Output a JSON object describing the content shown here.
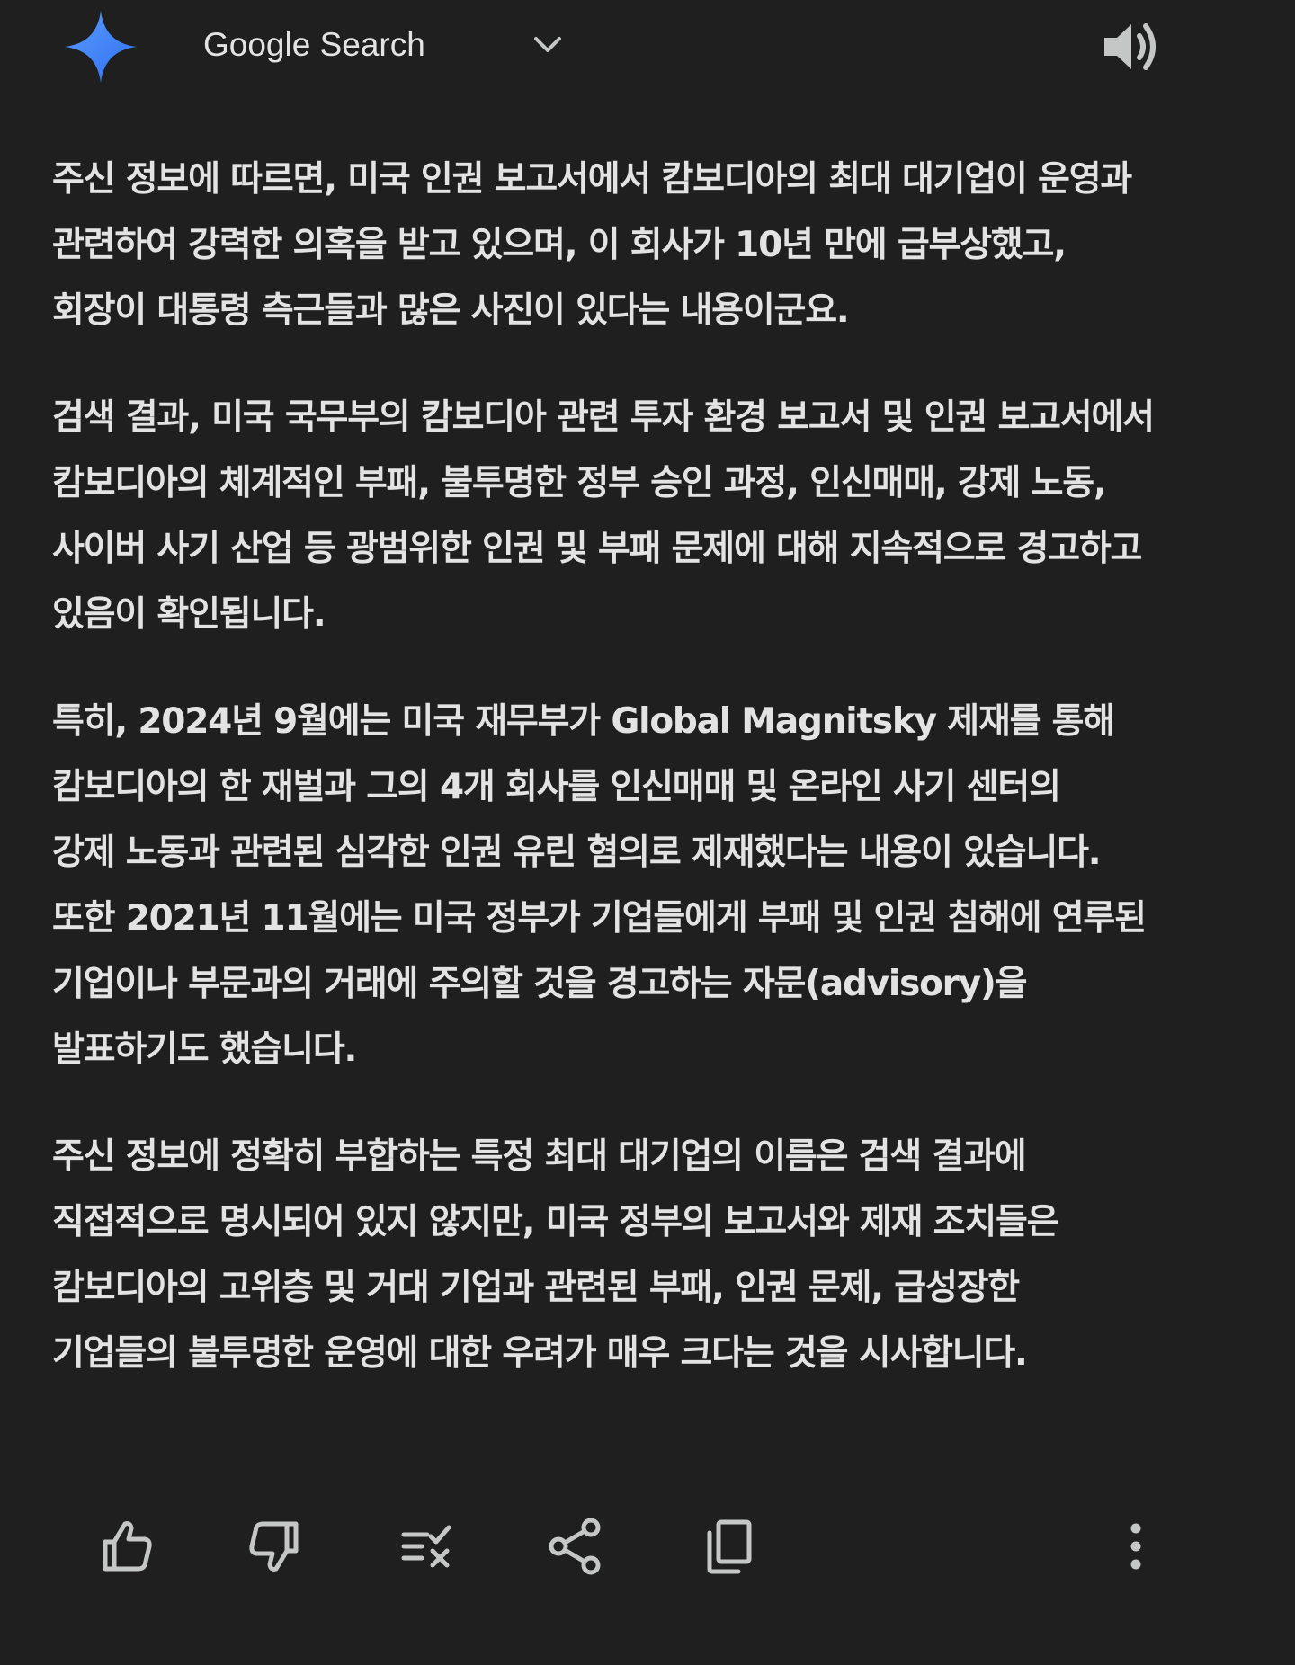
{
  "header": {
    "source_title": "Google Search",
    "logo_icon": "gemini-sparkle-icon",
    "dropdown_icon": "chevron-down-icon",
    "audio_icon": "speaker-icon",
    "accent_color": "#4285f4"
  },
  "answer": {
    "paragraphs": [
      "주신 정보에 따르면, 미국 인권 보고서에서 캄보디아의 최대 대기업이 운영과\n관련하여 강력한 의혹을 받고 있으며, 이 회사가 10년 만에 급부상했고,\n회장이 대통령 측근들과 많은 사진이 있다는 내용이군요.",
      "검색 결과, 미국 국무부의 캄보디아 관련 투자 환경 보고서 및 인권 보고서에서\n캄보디아의 체계적인 부패, 불투명한 정부 승인 과정, 인신매매, 강제 노동,\n사이버 사기 산업 등 광범위한 인권 및 부패 문제에 대해 지속적으로 경고하고\n있음이 확인됩니다.",
      "특히, 2024년 9월에는 미국 재무부가 Global Magnitsky 제재를 통해\n캄보디아의 한 재벌과 그의 4개 회사를 인신매매 및 온라인 사기 센터의\n강제 노동과 관련된 심각한 인권 유린 혐의로 제재했다는 내용이 있습니다.\n또한 2021년 11월에는 미국 정부가 기업들에게 부패 및 인권 침해에 연루된\n기업이나 부문과의 거래에 주의할 것을 경고하는 자문(advisory)을\n발표하기도 했습니다.",
      "주신 정보에 정확히 부합하는 특정 최대 대기업의 이름은 검색 결과에\n직접적으로 명시되어 있지 않지만, 미국 정부의 보고서와 제재 조치들은\n캄보디아의 고위층 및 거대 기업과 관련된 부패, 인권 문제, 급성장한\n기업들의 불투명한 운영에 대한 우려가 매우 크다는 것을 시사합니다."
    ]
  },
  "actions": {
    "icons": [
      "thumbs-up-icon",
      "thumbs-down-icon",
      "double-check-icon",
      "share-icon",
      "copy-icon",
      "more-vert-icon"
    ]
  }
}
